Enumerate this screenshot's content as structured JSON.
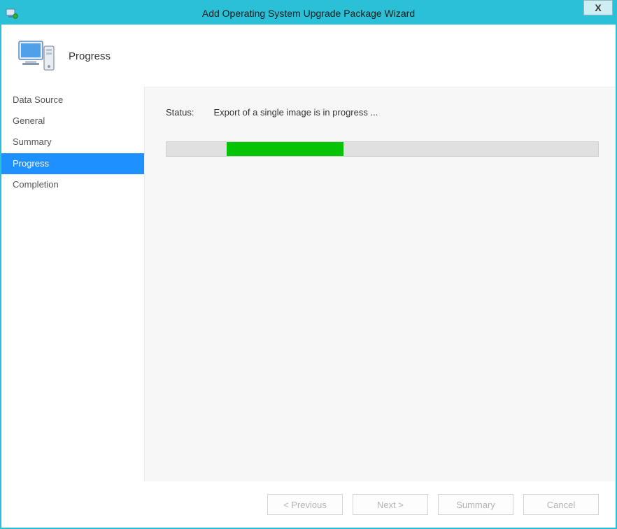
{
  "window": {
    "title": "Add Operating System Upgrade Package Wizard",
    "close_label": "X"
  },
  "header": {
    "heading": "Progress"
  },
  "sidebar": {
    "items": [
      {
        "label": "Data Source",
        "active": false
      },
      {
        "label": "General",
        "active": false
      },
      {
        "label": "Summary",
        "active": false
      },
      {
        "label": "Progress",
        "active": true
      },
      {
        "label": "Completion",
        "active": false
      }
    ]
  },
  "main": {
    "status_label": "Status:",
    "status_text": "Export of a single image is in progress ...",
    "progress_offset_percent": 14,
    "progress_width_percent": 27
  },
  "buttons": {
    "previous": "< Previous",
    "next": "Next >",
    "summary": "Summary",
    "cancel": "Cancel"
  }
}
